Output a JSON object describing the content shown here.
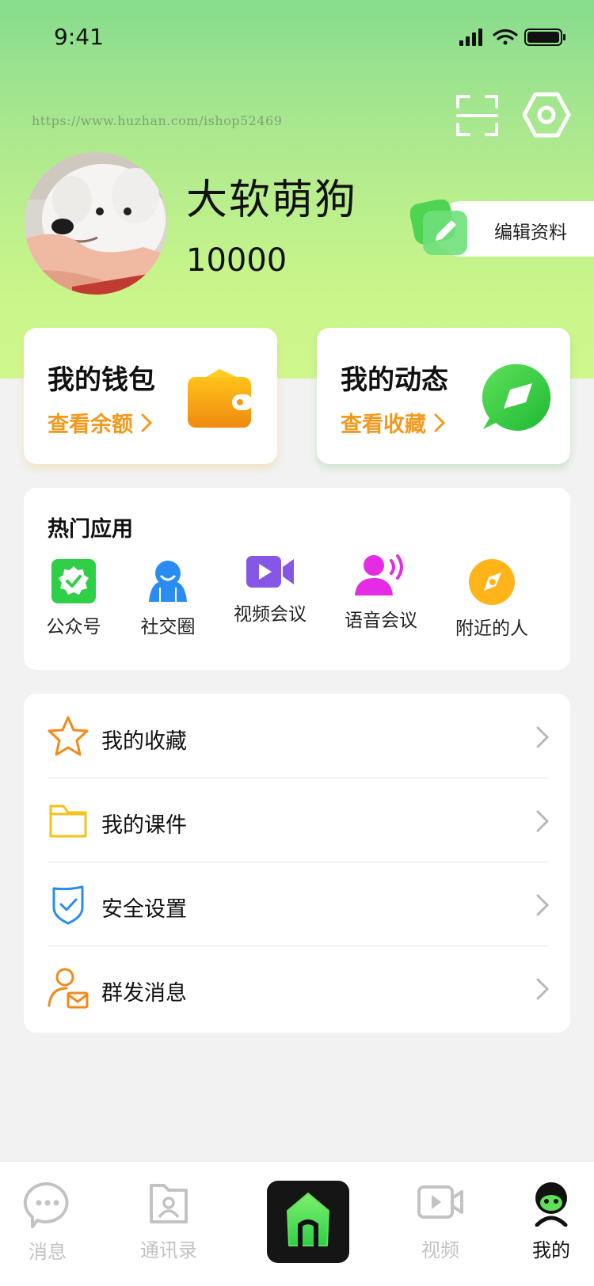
{
  "status_bar": {
    "time": "9:41"
  },
  "watermark": "https://www.huzhan.com/ishop52469",
  "profile": {
    "nickname": "大软萌狗",
    "user_id": "10000",
    "edit_label": "编辑资料"
  },
  "cards": {
    "wallet": {
      "title": "我的钱包",
      "link": "查看余额"
    },
    "moments": {
      "title": "我的动态",
      "link": "查看收藏"
    }
  },
  "hot_apps": {
    "title": "热门应用",
    "items": [
      {
        "label": "公众号",
        "icon": "official-account-icon"
      },
      {
        "label": "社交圈",
        "icon": "social-circle-icon"
      },
      {
        "label": "视频会议",
        "icon": "video-meeting-icon"
      },
      {
        "label": "语音会议",
        "icon": "voice-meeting-icon"
      },
      {
        "label": "附近的人",
        "icon": "compass-icon"
      }
    ]
  },
  "menu": {
    "items": [
      {
        "label": "我的收藏",
        "icon": "star-icon"
      },
      {
        "label": "我的课件",
        "icon": "folder-icon"
      },
      {
        "label": "安全设置",
        "icon": "shield-icon"
      },
      {
        "label": "群发消息",
        "icon": "user-mail-icon"
      }
    ]
  },
  "tabbar": {
    "items": [
      {
        "label": "消息",
        "icon": "chat-icon",
        "active": false
      },
      {
        "label": "通讯录",
        "icon": "contacts-icon",
        "active": false
      },
      {
        "label": "",
        "icon": "home-icon",
        "active": false
      },
      {
        "label": "视频",
        "icon": "video-icon",
        "active": false
      },
      {
        "label": "我的",
        "icon": "profile-icon",
        "active": true
      }
    ]
  },
  "colors": {
    "accent_orange": "#f39a1e",
    "accent_green": "#3ccb43",
    "hero_top": "#87dc8d",
    "hero_bottom": "#cff78c"
  }
}
